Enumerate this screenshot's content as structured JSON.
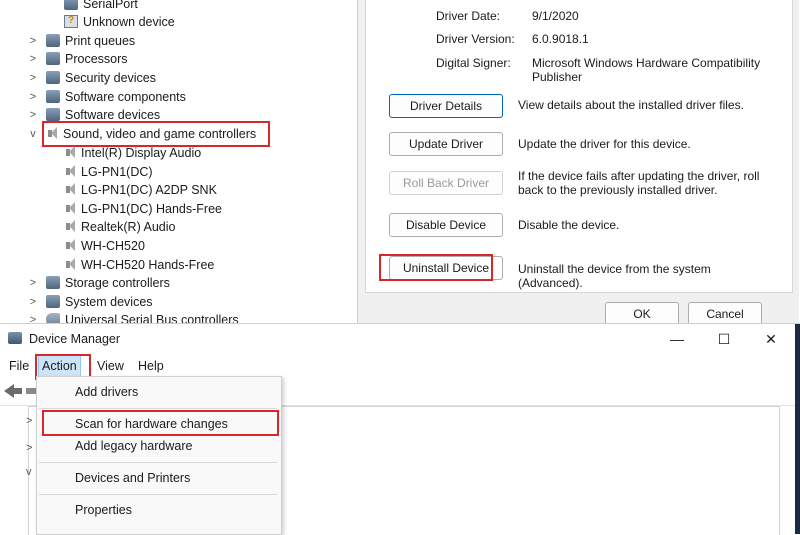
{
  "tree_top": {
    "rows": [
      {
        "label": "SerialPort",
        "expander": ""
      },
      {
        "label": "Unknown device",
        "expander": ""
      },
      {
        "label": "Print queues",
        "expander": ">"
      },
      {
        "label": "Processors",
        "expander": ">"
      },
      {
        "label": "Security devices",
        "expander": ">"
      },
      {
        "label": "Software components",
        "expander": ">"
      },
      {
        "label": "Software devices",
        "expander": ">"
      },
      {
        "label": "Sound, video and game controllers",
        "expander": "v"
      },
      {
        "label": "Intel(R) Display Audio",
        "expander": ""
      },
      {
        "label": "LG-PN1(DC)",
        "expander": ""
      },
      {
        "label": "LG-PN1(DC) A2DP SNK",
        "expander": ""
      },
      {
        "label": "LG-PN1(DC) Hands-Free",
        "expander": ""
      },
      {
        "label": "Realtek(R) Audio",
        "expander": ""
      },
      {
        "label": "WH-CH520",
        "expander": ""
      },
      {
        "label": "WH-CH520 Hands-Free",
        "expander": ""
      },
      {
        "label": "Storage controllers",
        "expander": ">"
      },
      {
        "label": "System devices",
        "expander": ">"
      },
      {
        "label": "Universal Serial Bus controllers",
        "expander": ">"
      }
    ]
  },
  "driver_props": {
    "driver_date_label": "Driver Date:",
    "driver_date_value": "9/1/2020",
    "driver_version_label": "Driver Version:",
    "driver_version_value": "6.0.9018.1",
    "digital_signer_label": "Digital Signer:",
    "digital_signer_value": "Microsoft Windows Hardware Compatibility Publisher",
    "buttons": [
      {
        "label": "Driver Details",
        "desc": "View details about the installed driver files."
      },
      {
        "label": "Update Driver",
        "desc": "Update the driver for this device."
      },
      {
        "label": "Roll Back Driver",
        "desc": "If the device fails after updating the driver, roll back to the previously installed driver."
      },
      {
        "label": "Disable Device",
        "desc": "Disable the device."
      },
      {
        "label": "Uninstall Device",
        "desc": "Uninstall the device from the system (Advanced)."
      }
    ],
    "ok_label": "OK",
    "cancel_label": "Cancel"
  },
  "window": {
    "title": "Device Manager",
    "minimize": "—",
    "maximize": "☐",
    "close": "✕"
  },
  "menu": {
    "file": "File",
    "action": "Action",
    "view": "View",
    "help": "Help"
  },
  "action_menu": {
    "items": [
      "Add drivers",
      "Scan for hardware changes",
      "Add legacy hardware",
      "Devices and Printers",
      "Properties"
    ]
  },
  "content_tree": {
    "collapsed_symbol": ">",
    "expanded_symbol": "v"
  },
  "colors": {
    "highlight_red": "#d9262b",
    "menu_active_bg": "#cce4f7",
    "focus_blue": "#0067c0"
  }
}
